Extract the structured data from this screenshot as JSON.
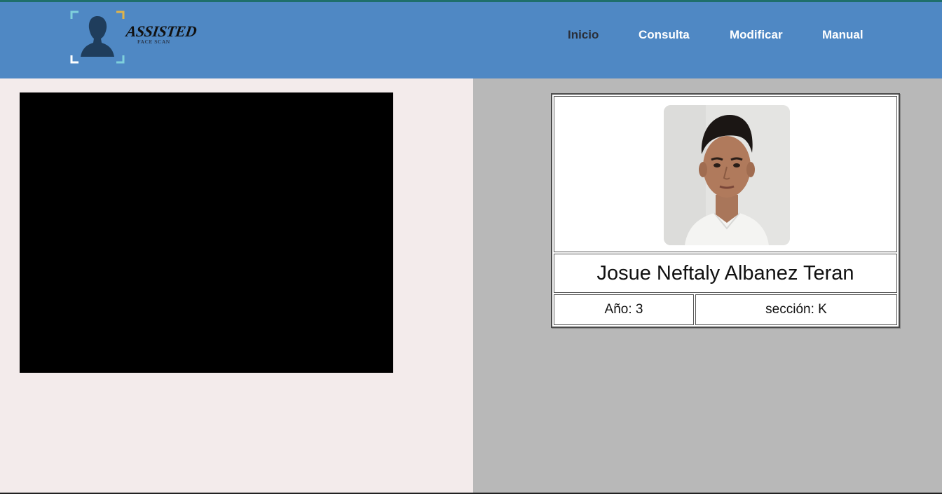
{
  "header": {
    "logo_text": "ASSISTED",
    "logo_subtext": "FACE SCAN",
    "nav": {
      "inicio": "Inicio",
      "consulta": "Consulta",
      "modificar": "Modificar",
      "manual": "Manual"
    },
    "active_nav": "Inicio"
  },
  "camera": {
    "feed_state": "black"
  },
  "student": {
    "name": "Josue Neftaly Albanez Teran",
    "year": "Año: 3",
    "section": "sección: K"
  },
  "colors": {
    "header_bg": "#4f88c4",
    "left_bg": "#f3ebeb",
    "right_bg": "#b8b8b8",
    "accent_line": "#1f6f6b"
  }
}
